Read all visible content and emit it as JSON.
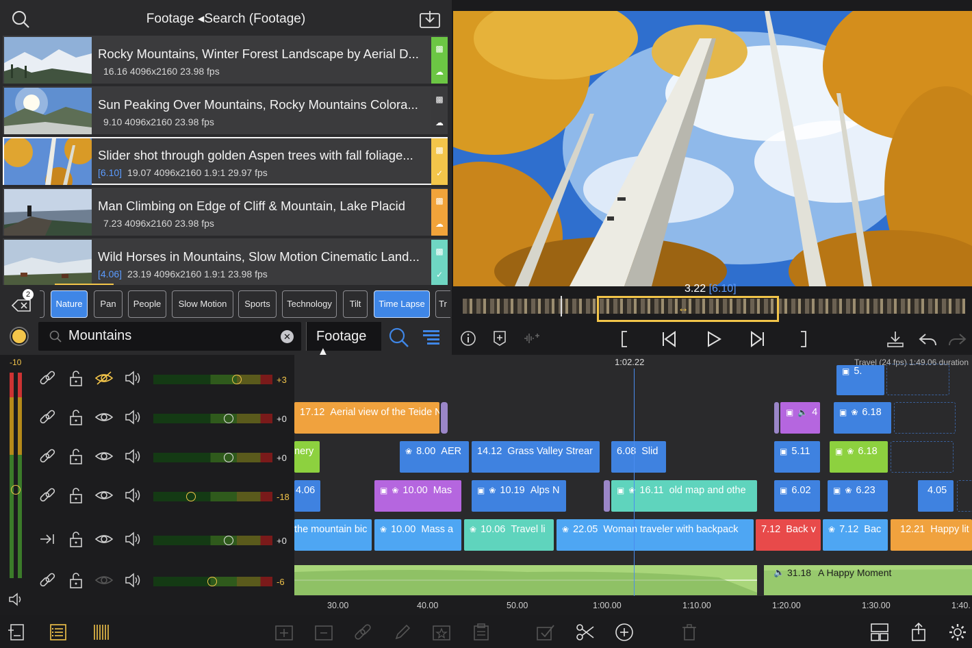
{
  "library": {
    "title": "Footage ◂Search (Footage)",
    "clips": [
      {
        "title": "Rocky Mountains, Winter Forest Landscape by Aerial D...",
        "range": "",
        "meta": "16.16  4096x2160  23.98 fps",
        "strip_color": "#6cc644",
        "icon": "film-icon"
      },
      {
        "title": "Sun Peaking Over Mountains, Rocky Mountains Colora...",
        "range": "",
        "meta": "9.10  4096x2160  23.98 fps",
        "strip_color": "#3a3a3c",
        "icon": "film-icon"
      },
      {
        "title": "Slider shot through golden Aspen trees with fall foliage...",
        "range": "[6.10]",
        "meta": "19.07  4096x2160  1.9:1  29.97 fps",
        "strip_color": "#f3c54a",
        "icon": "checkmark-icon"
      },
      {
        "title": "Man Climbing on Edge of Cliff & Mountain, Lake Placid",
        "range": "",
        "meta": "7.23  4096x2160  23.98 fps",
        "strip_color": "#f1a33a",
        "icon": "film-icon"
      },
      {
        "title": "Wild Horses in Mountains, Slow Motion Cinematic Land...",
        "range": "[4.06]",
        "meta": "23.19  4096x2160  1.9:1  23.98 fps",
        "strip_color": "#6fd6c3",
        "icon": "checkmark-icon"
      }
    ],
    "filter_badge": "2",
    "tags": [
      {
        "label": "Nature",
        "active": true
      },
      {
        "label": "Pan",
        "active": false
      },
      {
        "label": "People",
        "active": false
      },
      {
        "label": "Slow Motion",
        "active": false
      },
      {
        "label": "Sports",
        "active": false
      },
      {
        "label": "Technology",
        "active": false
      },
      {
        "label": "Tilt",
        "active": false
      },
      {
        "label": "Time Lapse",
        "active": true
      },
      {
        "label": "Tr",
        "active": false
      }
    ],
    "search_value": "Mountains",
    "scope_label": "Footage ▲"
  },
  "viewer": {
    "scrub_time": "3.22",
    "scrub_range": "[6.10]"
  },
  "timeline": {
    "playhead_time": "1:02.22",
    "info": "Travel (24 fps)  1:49.06 duration",
    "ruler": [
      "30.00",
      "40.00",
      "50.00",
      "1:00.00",
      "1:10.00",
      "1:20.00",
      "1:30.00",
      "1:40."
    ],
    "track_volumes": [
      "+3",
      "+0",
      "+0",
      "-18",
      "+0",
      "-6"
    ],
    "meter_label": "-10",
    "clips": {
      "c_r0a": "5.",
      "c_r1a": {
        "num": "17.12",
        "text": "Aerial view of the Teide N"
      },
      "c_r1b": "4",
      "c_r1c": "6.18",
      "c_r2a": "nery",
      "c_r2b": {
        "num": "8.00",
        "text": "AER"
      },
      "c_r2c": {
        "num": "14.12",
        "text": "Grass Valley Strear"
      },
      "c_r2d": {
        "num": "6.08",
        "text": "Slid"
      },
      "c_r2e": "5.11",
      "c_r2f": "6.18",
      "c_r3a": "4.06",
      "c_r3b": {
        "num": "10.00",
        "text": "Mas"
      },
      "c_r3c": {
        "num": "10.19",
        "text": "Alps N"
      },
      "c_r3d": {
        "num": "16.11",
        "text": "old map and othe"
      },
      "c_r3e": "6.02",
      "c_r3f": "6.23",
      "c_r3g": "4.05",
      "c_r4a": "the mountain bic",
      "c_r4b": {
        "num": "10.00",
        "text": "Mass a"
      },
      "c_r4c": {
        "num": "10.06",
        "text": "Travel li"
      },
      "c_r4d": {
        "num": "22.05",
        "text": "Woman traveler with backpack"
      },
      "c_r4e": {
        "num": "7.12",
        "text": "Back v"
      },
      "c_r4f": {
        "num": "7.12",
        "text": "Bac"
      },
      "c_r4g": {
        "num": "12.21",
        "text": "Happy lit"
      },
      "audio": {
        "num": "31.18",
        "text": "A Happy Moment"
      }
    }
  },
  "colors": {
    "orange": "#f0a23e",
    "green": "#8dd13f",
    "blue": "#3f82e0",
    "purple": "#b566df",
    "teal": "#5fd4bd",
    "lightblue": "#4ea6f3",
    "red": "#e84a4a",
    "audio": "#a9d67a"
  }
}
